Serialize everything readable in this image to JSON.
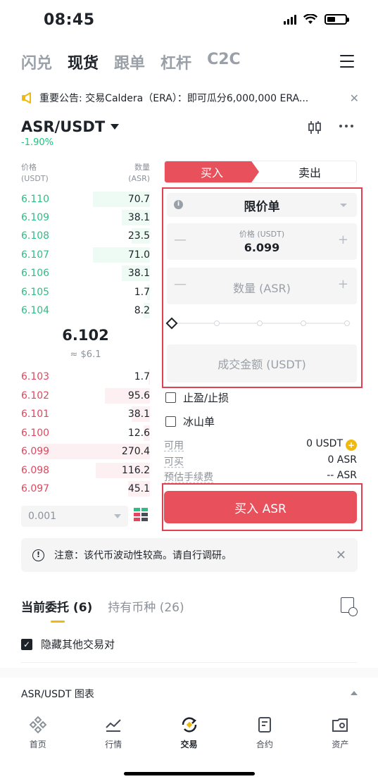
{
  "status_bar": {
    "time": "08:45"
  },
  "top_tabs": [
    "闪兑",
    "现货",
    "跟单",
    "杠杆",
    "C2C"
  ],
  "active_top_tab": 1,
  "announcement": {
    "text": "重要公告: 交易Caldera（ERA）：即可瓜分6,000,000 ERA..."
  },
  "pair": {
    "symbol": "ASR/USDT",
    "change": "-1.90%"
  },
  "orderbook": {
    "price_header": [
      "价格",
      "(USDT)"
    ],
    "qty_header": [
      "数量",
      "(ASR)"
    ],
    "asks": [
      {
        "price": "6.110",
        "qty": "70.7",
        "depth": 0.44
      },
      {
        "price": "6.109",
        "qty": "38.1",
        "depth": 0.22
      },
      {
        "price": "6.108",
        "qty": "23.5",
        "depth": 0.14
      },
      {
        "price": "6.107",
        "qty": "71.0",
        "depth": 0.44
      },
      {
        "price": "6.106",
        "qty": "38.1",
        "depth": 0.22
      },
      {
        "price": "6.105",
        "qty": "1.7",
        "depth": 0.02
      },
      {
        "price": "6.104",
        "qty": "8.2",
        "depth": 0.05
      }
    ],
    "mid_price": "6.102",
    "mid_usd": "≈ $6.1",
    "bids": [
      {
        "price": "6.103",
        "qty": "1.7",
        "depth": 0.01
      },
      {
        "price": "6.102",
        "qty": "95.6",
        "depth": 0.35
      },
      {
        "price": "6.101",
        "qty": "38.1",
        "depth": 0.14
      },
      {
        "price": "6.100",
        "qty": "12.6",
        "depth": 0.05
      },
      {
        "price": "6.099",
        "qty": "270.4",
        "depth": 0.85
      },
      {
        "price": "6.098",
        "qty": "116.2",
        "depth": 0.42
      },
      {
        "price": "6.097",
        "qty": "45.1",
        "depth": 0.17
      }
    ],
    "precision": "0.001"
  },
  "trade": {
    "buy_tab": "买入",
    "sell_tab": "卖出",
    "order_type": "限价单",
    "price_label": "价格 (USDT)",
    "price_value": "6.099",
    "qty_placeholder": "数量 (ASR)",
    "total_placeholder": "成交金额 (USDT)",
    "tp_sl": "止盈/止损",
    "iceberg": "冰山单",
    "available_label": "可用",
    "available_value": "0 USDT",
    "buyable_label": "可买",
    "buyable_value": "0 ASR",
    "fee_label": "预估手续费",
    "fee_value": "-- ASR",
    "buy_button": "买入 ASR"
  },
  "notice": {
    "text": "注意：该代币波动性较高。请自行调研。"
  },
  "orders": {
    "tab_open": "当前委托 (6)",
    "tab_holdings": "持有币种 (26)",
    "hide_others": "隐藏其他交易对",
    "chart_label": "ASR/USDT 图表"
  },
  "bottom_nav": [
    "首页",
    "行情",
    "交易",
    "合约",
    "资产"
  ],
  "active_nav": 2,
  "colors": {
    "green": "#2ebd85",
    "red": "#e8505b",
    "yellow": "#f0b90b"
  }
}
